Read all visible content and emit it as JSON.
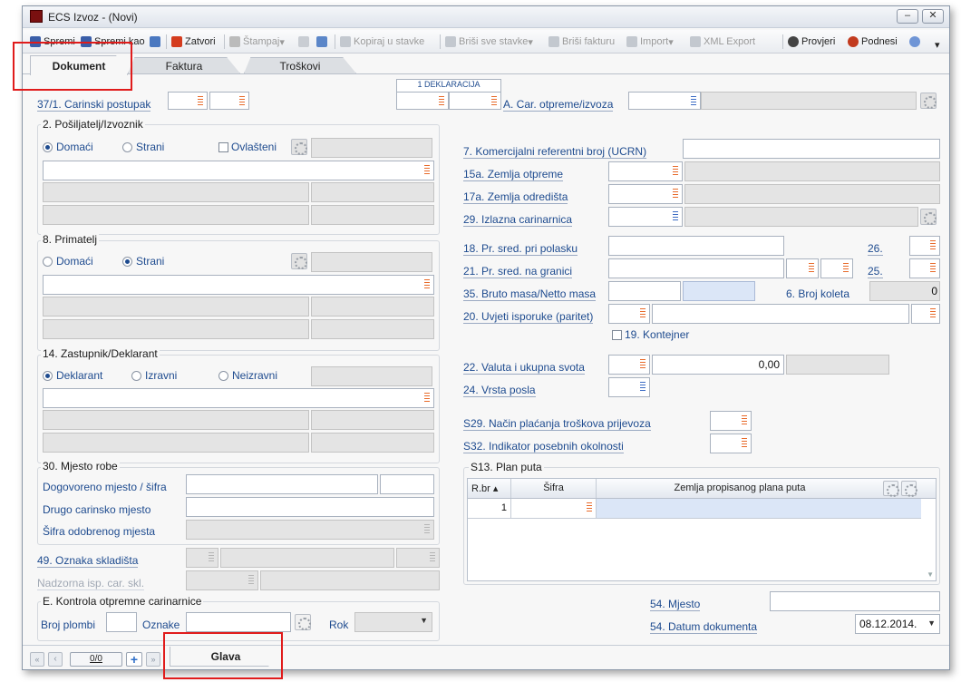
{
  "window": {
    "title": "ECS Izvoz - (Novi)"
  },
  "toolbar": {
    "spremi": "Spremi",
    "spremi_kao": "Spremi kao",
    "zatvori": "Zatvori",
    "stampaj": "Štampaj",
    "kopiraj": "Kopiraj u stavke",
    "brisi_sve": "Briši sve stavke",
    "brisi_fakturu": "Briši fakturu",
    "import": "Import",
    "xml_export": "XML Export",
    "provjeri": "Provjeri",
    "podnesi": "Podnesi"
  },
  "tabs": [
    "Dokument",
    "Faktura",
    "Troškovi"
  ],
  "header": {
    "deklaracija": "1 DEKLARACIJA",
    "carinski_postupak": "37/1. Carinski postupak",
    "car_otpreme": "A. Car. otpreme/izvoza"
  },
  "posiljatelj": {
    "title": "2. Pošiljatelj/Izvoznik",
    "domaci": "Domaći",
    "strani": "Strani",
    "ovlasteni": "Ovlašteni"
  },
  "primatelj": {
    "title": "8. Primatelj",
    "domaci": "Domaći",
    "strani": "Strani"
  },
  "zastupnik": {
    "title": "14. Zastupnik/Deklarant",
    "deklarant": "Deklarant",
    "izravni": "Izravni",
    "neizravni": "Neizravni"
  },
  "mjesto": {
    "title": "30. Mjesto robe",
    "dogovoreno": "Dogovoreno mjesto / šifra",
    "drugo": "Drugo carinsko mjesto",
    "sifra": "Šifra odobrenog mjesta"
  },
  "skladiste": {
    "oznaka": "49. Oznaka skladišta",
    "nadzorna": "Nadzorna isp. car. skl."
  },
  "kontrola": {
    "title": "E. Kontrola otpremne carinarnice",
    "plombi": "Broj plombi",
    "oznake": "Oznake",
    "rok": "Rok"
  },
  "right": {
    "ucrn": "7. Komercijalni referentni broj (UCRN)",
    "zemlja_otpreme": "15a. Zemlja otpreme",
    "zemlja_odredista": "17a. Zemlja odredišta",
    "izlazna": "29. Izlazna carinarnica",
    "sred_polasku": "18. Pr. sred. pri polasku",
    "sred_granici": "21. Pr. sred. na granici",
    "l26": "26.",
    "l25": "25.",
    "masa": "35. Bruto masa/Netto masa",
    "koleta": "6. Broj koleta",
    "koleta_val": "0",
    "uvjeti": "20. Uvjeti isporuke (paritet)",
    "kontejner": "19. Kontejner",
    "valuta": "22. Valuta i ukupna svota",
    "valuta_val": "0,00",
    "posla": "24. Vrsta posla",
    "s29": "S29. Način plaćanja troškova prijevoza",
    "s32": "S32. Indikator posebnih okolnosti",
    "plan": "S13. Plan puta",
    "mjesto54": "54. Mjesto",
    "datum54": "54. Datum dokumenta",
    "datum_val": "08.12.2014."
  },
  "plan_table": {
    "headers": [
      "R.br",
      "Šifra",
      "Zemlja propisanog plana puta"
    ],
    "rows": [
      [
        "1",
        "",
        ""
      ]
    ]
  },
  "footer": {
    "nav": "0/0",
    "tab": "Glava"
  }
}
